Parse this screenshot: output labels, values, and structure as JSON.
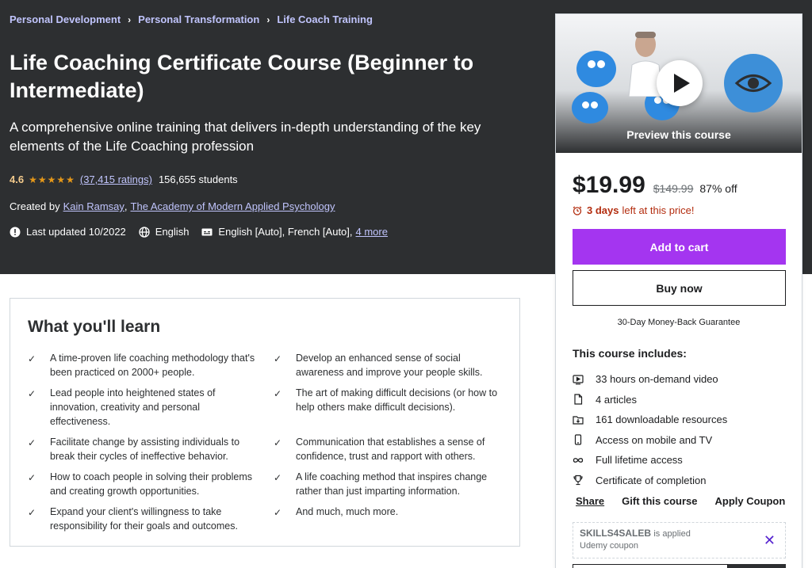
{
  "breadcrumb": [
    "Personal Development",
    "Personal Transformation",
    "Life Coach Training"
  ],
  "course": {
    "title": "Life Coaching Certificate Course (Beginner to Intermediate)",
    "headline": "A comprehensive online training that delivers in-depth understanding of the key elements of the Life Coaching profession",
    "rating": "4.6",
    "ratings_count": "(37,415 ratings)",
    "students": "156,655 students",
    "created_by_label": "Created by",
    "authors": [
      "Kain Ramsay",
      "The Academy of Modern Applied Psychology"
    ],
    "last_updated": "Last updated 10/2022",
    "language": "English",
    "captions": "English [Auto], French [Auto],",
    "more_captions": "4 more"
  },
  "sidebar": {
    "preview_label": "Preview this course",
    "price": "$19.99",
    "original_price": "$149.99",
    "discount": "87% off",
    "timer_days": "3 days",
    "timer_text": "left at this price!",
    "add_to_cart": "Add to cart",
    "buy_now": "Buy now",
    "guarantee": "30-Day Money-Back Guarantee",
    "includes_title": "This course includes:",
    "includes": [
      {
        "icon": "video-icon",
        "text": "33 hours on-demand video"
      },
      {
        "icon": "file-icon",
        "text": "4 articles"
      },
      {
        "icon": "folder-download-icon",
        "text": "161 downloadable resources"
      },
      {
        "icon": "mobile-icon",
        "text": "Access on mobile and TV"
      },
      {
        "icon": "infinity-icon",
        "text": "Full lifetime access"
      },
      {
        "icon": "trophy-icon",
        "text": "Certificate of completion"
      }
    ],
    "actions": [
      "Share",
      "Gift this course",
      "Apply Coupon"
    ],
    "coupon": {
      "code": "SKILLS4SALEB",
      "applied": "is applied",
      "sub": "Udemy coupon"
    }
  },
  "learn": {
    "title": "What you'll learn",
    "items": [
      "A time-proven life coaching methodology that's been practiced on 2000+ people.",
      "Develop an enhanced sense of social awareness and improve your people skills.",
      "Lead people into heightened states of innovation, creativity and personal effectiveness.",
      "The art of making difficult decisions (or how to help others make difficult decisions).",
      "Facilitate change by assisting individuals to break their cycles of ineffective behavior.",
      "Communication that establishes a sense of confidence, trust and rapport with others.",
      "How to coach people in solving their problems and creating growth opportunities.",
      "A life coaching method that inspires change rather than just imparting information.",
      "Expand your client's willingness to take responsibility for their goals and outcomes.",
      "And much, much more."
    ]
  },
  "colors": {
    "hero_bg": "#2d2f31",
    "accent_purple": "#a435f0",
    "link_lavender": "#c0c4fc",
    "star": "#e59819",
    "timer_red": "#b32d0f"
  }
}
